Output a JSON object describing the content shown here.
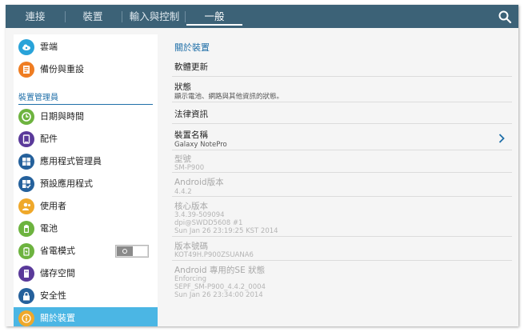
{
  "top_tabs": [
    {
      "label": "連接"
    },
    {
      "label": "裝置"
    },
    {
      "label": "輸入與控制"
    },
    {
      "label": "一般"
    }
  ],
  "sidebar": {
    "section_header": "裝置管理員",
    "items": [
      {
        "label": "雲端",
        "icon": "cloud-icon",
        "color": "#29a3d9"
      },
      {
        "label": "備份與重設",
        "icon": "backup-icon",
        "color": "#ef7d22"
      },
      {
        "label": "日期與時間",
        "icon": "clock-icon",
        "color": "#6db33f"
      },
      {
        "label": "配件",
        "icon": "accessory-icon",
        "color": "#5a3a9a"
      },
      {
        "label": "應用程式管理員",
        "icon": "grid-icon",
        "color": "#25619c"
      },
      {
        "label": "預設應用程式",
        "icon": "default-apps-icon",
        "color": "#25619c"
      },
      {
        "label": "使用者",
        "icon": "user-icon",
        "color": "#efa82a"
      },
      {
        "label": "電池",
        "icon": "battery-icon",
        "color": "#6db33f"
      },
      {
        "label": "省電模式",
        "icon": "power-saving-icon",
        "color": "#6db33f"
      },
      {
        "label": "儲存空間",
        "icon": "storage-icon",
        "color": "#5a3a9a"
      },
      {
        "label": "安全性",
        "icon": "lock-icon",
        "color": "#25619c"
      },
      {
        "label": "關於裝置",
        "icon": "info-icon",
        "color": "#efa82a"
      }
    ],
    "power_saving_toggle": {
      "on": false
    },
    "selected_color": "#4bb6e4"
  },
  "about": {
    "title": "關於裝置",
    "software_update": "軟體更新",
    "status": {
      "title": "狀態",
      "sub": "顯示電池、網路與其他資訊的狀態。"
    },
    "legal": "法律資訊",
    "device_name": {
      "title": "裝置名稱",
      "value": "Galaxy NotePro"
    },
    "model": {
      "title": "型號",
      "value": "SM-P900"
    },
    "android_version": {
      "title": "Android版本",
      "value": "4.4.2"
    },
    "kernel": {
      "title": "核心版本",
      "line1": "3.4.39-509094",
      "line2": "dpi@SWDD5608 #1",
      "line3": "Sun Jan 26 23:19:25 KST 2014"
    },
    "build": {
      "title": "版本號碼",
      "value": "KOT49H.P900ZSUANA6"
    },
    "se_status": {
      "title": "Android 專用的SE 狀態",
      "line1": "Enforcing",
      "line2": "SEPF_SM-P900_4.4.2_0004",
      "line3": "Sun Jan 26 23:34:00 2014"
    }
  },
  "colors": {
    "topbar": "#3c6277",
    "accent": "#1f6fa8"
  }
}
